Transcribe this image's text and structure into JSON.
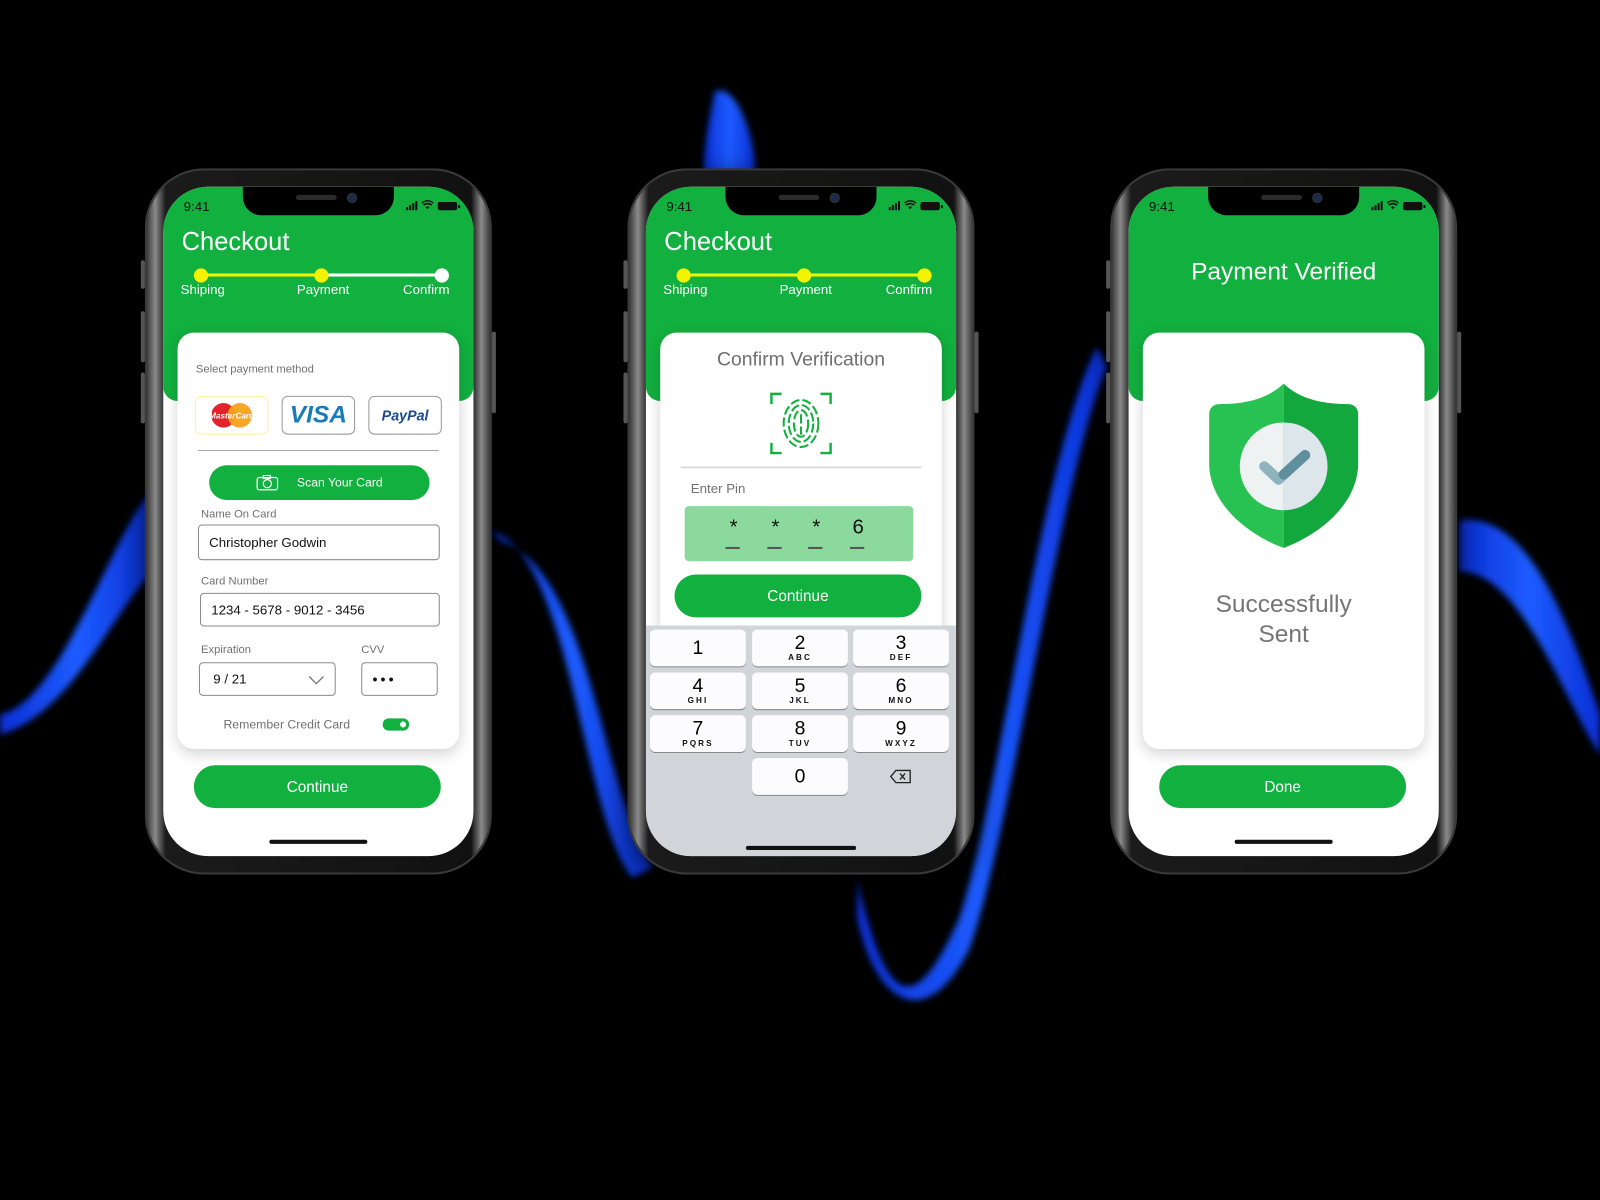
{
  "colors": {
    "brand_green": "#12b03f",
    "progress_active": "#f3f300",
    "progress_inactive": "#ffffff",
    "pin_bg": "#8bd99c",
    "keypad_bg": "#d1d4d9"
  },
  "status_bar": {
    "time": "9:41"
  },
  "screens": [
    {
      "title": "Checkout",
      "steps": [
        {
          "label": "Shiping",
          "done": true
        },
        {
          "label": "Payment",
          "done": true
        },
        {
          "label": "Confirm",
          "done": false
        }
      ],
      "select_payment_label": "Select payment method",
      "payment_methods": [
        {
          "name": "MasterCard",
          "selected": true
        },
        {
          "name": "VISA",
          "selected": false
        },
        {
          "name": "PayPal",
          "selected": false
        }
      ],
      "scan_button": "Scan Your Card",
      "name_label": "Name On Card",
      "name_value": "Christopher Godwin",
      "card_number_label": "Card Number",
      "card_number_value": "1234 - 5678 - 9012 - 3456",
      "expiration_label": "Expiration",
      "expiration_value": "9 / 21",
      "cvv_label": "CVV",
      "cvv_value": "•••",
      "remember_label": "Remember Credit Card",
      "remember_on": true,
      "continue_button": "Continue"
    },
    {
      "title": "Checkout",
      "steps": [
        {
          "label": "Shiping",
          "done": true
        },
        {
          "label": "Payment",
          "done": true
        },
        {
          "label": "Confirm",
          "done": true
        }
      ],
      "card_title": "Confirm Verification",
      "pin_label": "Enter Pin",
      "pin_digits": [
        "*",
        "*",
        "*",
        "6"
      ],
      "continue_button": "Continue",
      "keys": [
        {
          "n": "1",
          "l": ""
        },
        {
          "n": "2",
          "l": "ABC"
        },
        {
          "n": "3",
          "l": "DEF"
        },
        {
          "n": "4",
          "l": "GHI"
        },
        {
          "n": "5",
          "l": "JKL"
        },
        {
          "n": "6",
          "l": "MNO"
        },
        {
          "n": "7",
          "l": "PQRS"
        },
        {
          "n": "8",
          "l": "TUV"
        },
        {
          "n": "9",
          "l": "WXYZ"
        },
        {
          "n": "0",
          "l": ""
        }
      ]
    },
    {
      "title": "Payment Verified",
      "message_line1": "Successfully",
      "message_line2": "Sent",
      "done_button": "Done"
    }
  ]
}
